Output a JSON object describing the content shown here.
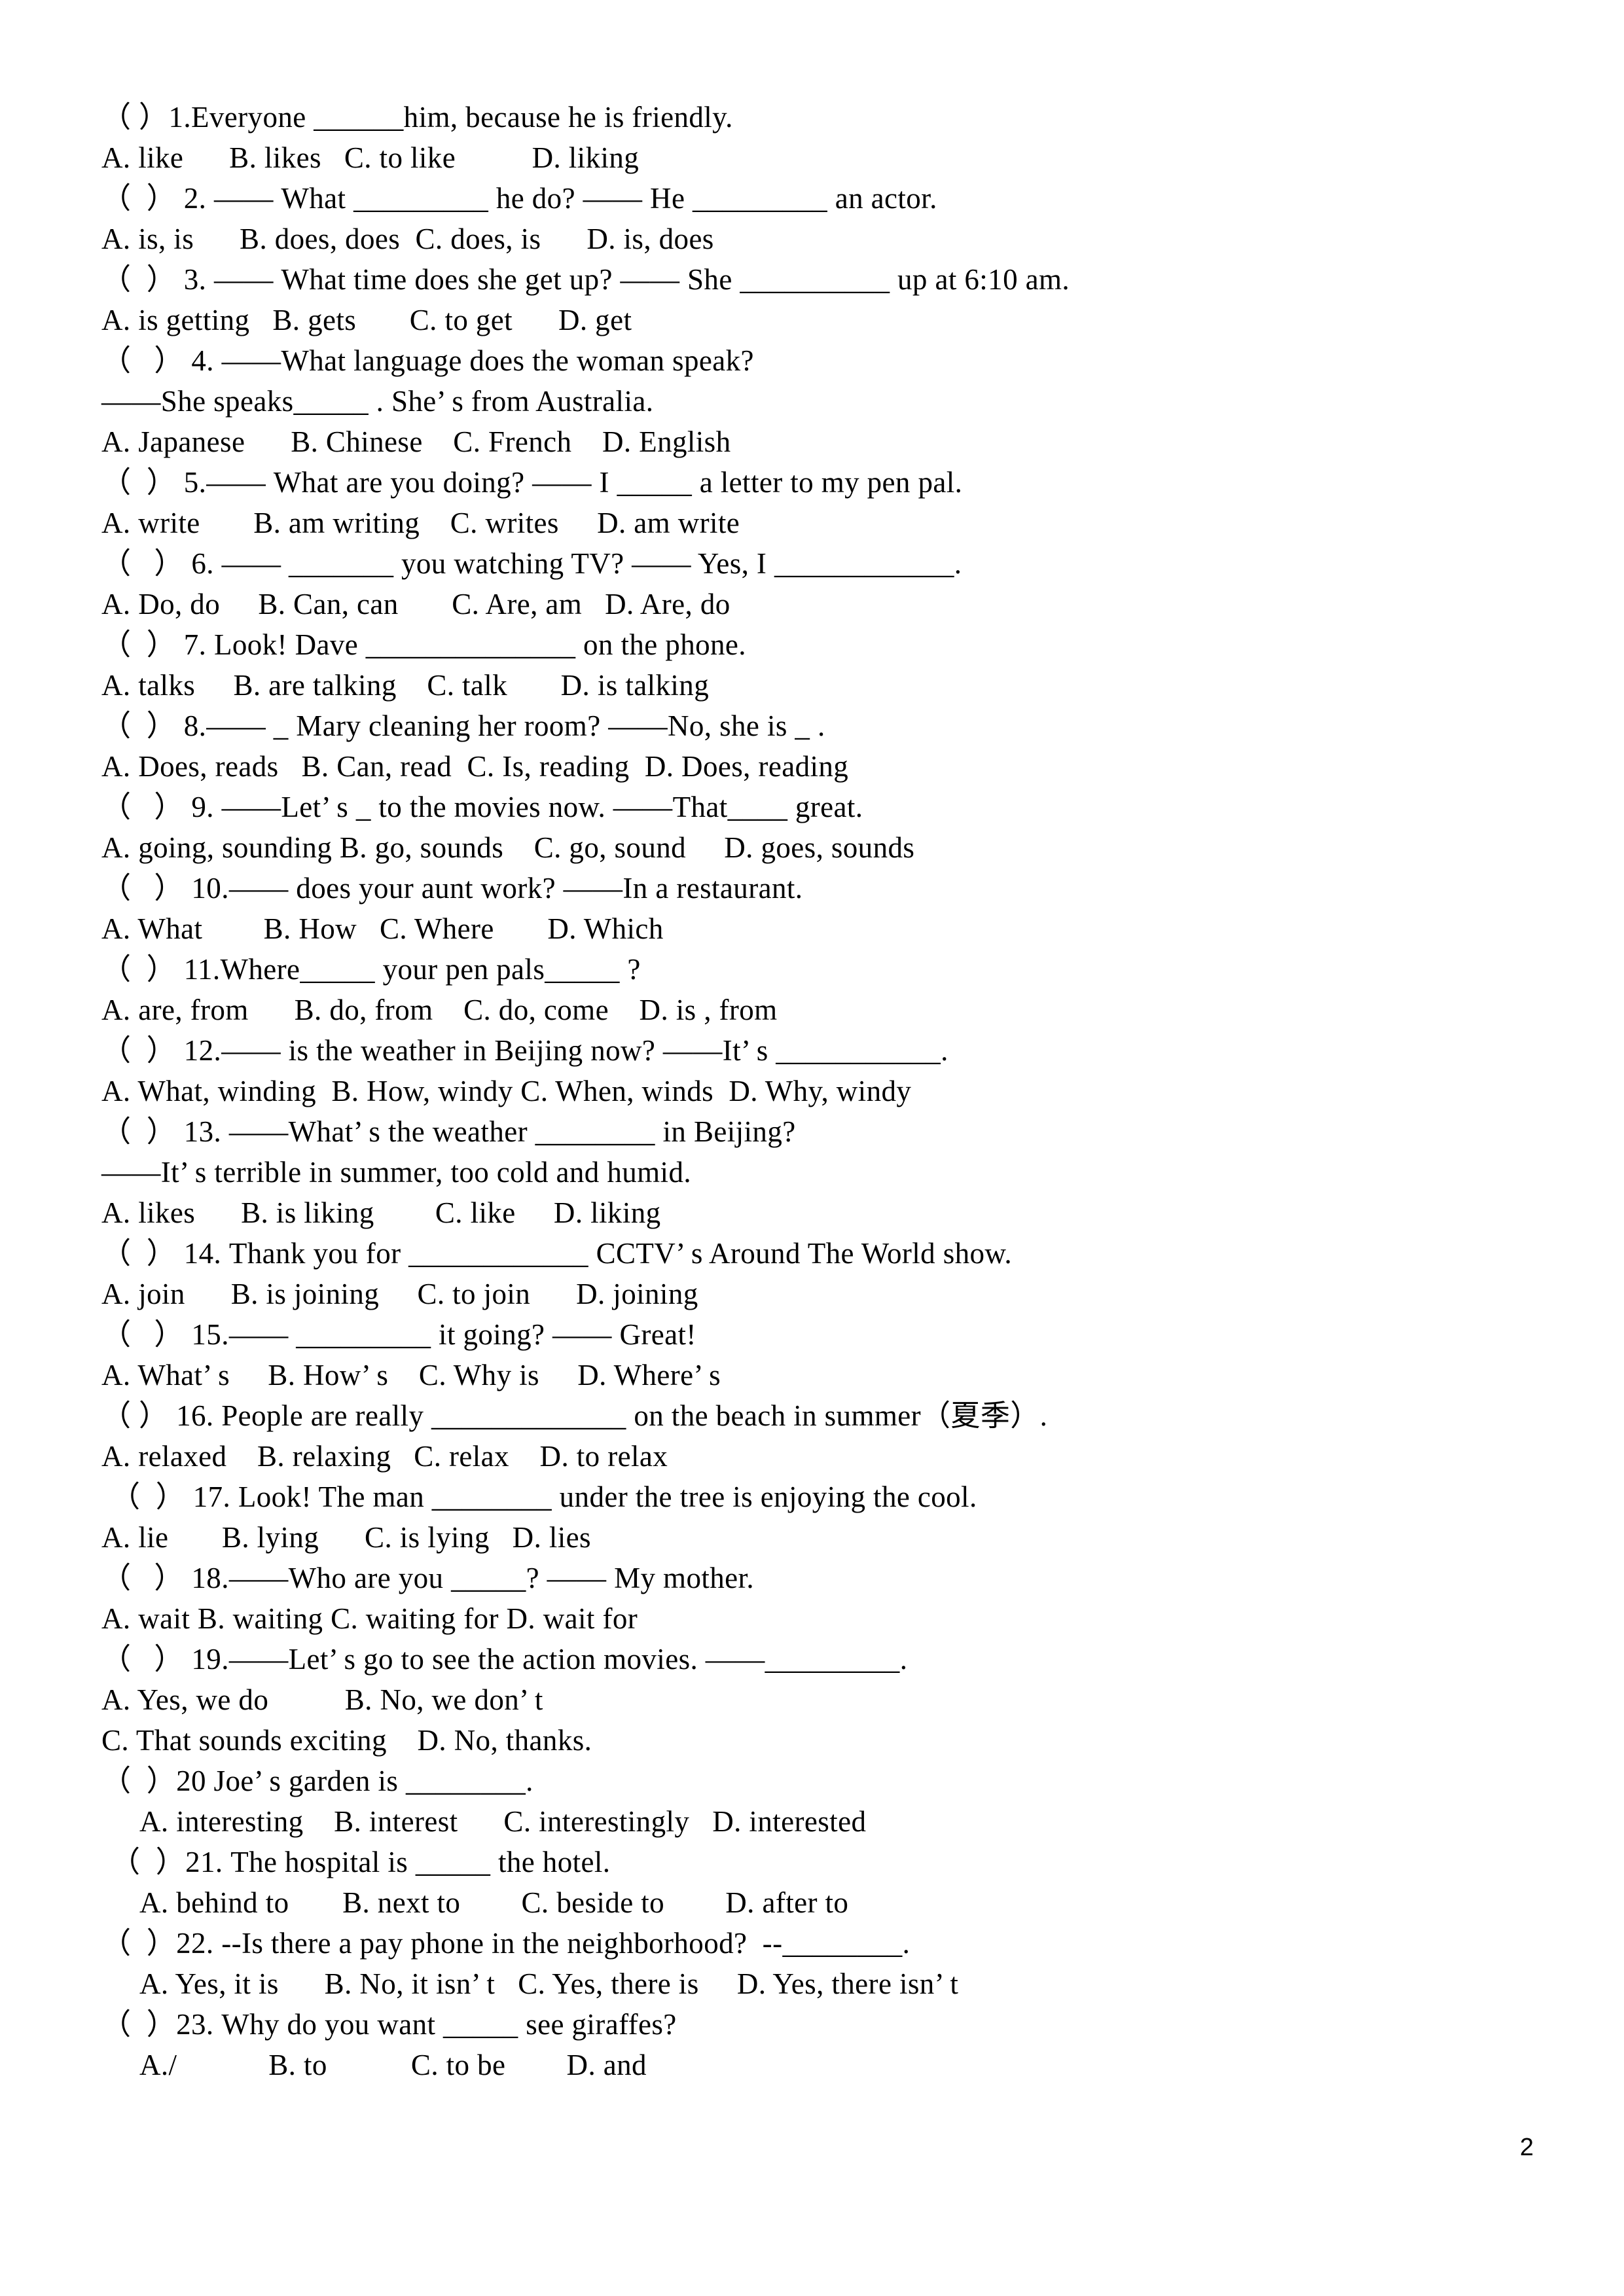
{
  "document": {
    "page_number": "2",
    "type": "multiple-choice-grammar-worksheet"
  },
  "lines": [
    {
      "id": "q1-stem",
      "indent": 0,
      "text": "（ ）1.Everyone ______him, because he is friendly."
    },
    {
      "id": "q1-options",
      "indent": 0,
      "text": "A. like      B. likes   C. to like          D. liking"
    },
    {
      "id": "q2-stem",
      "indent": 0,
      "text": "（  ） 2. —— What _________ he do? —— He _________ an actor."
    },
    {
      "id": "q2-options",
      "indent": 0,
      "text": "A. is, is      B. does, does  C. does, is      D. is, does"
    },
    {
      "id": "q3-stem",
      "indent": 0,
      "text": "（  ） 3. —— What time does she get up? —— She __________ up at 6:10 am."
    },
    {
      "id": "q3-options",
      "indent": 0,
      "text": "A. is getting   B. gets       C. to get      D. get"
    },
    {
      "id": "q4-stem",
      "indent": 0,
      "text": "（   ） 4. ——What language does the woman speak?"
    },
    {
      "id": "q4-stem2",
      "indent": 0,
      "text": "——She speaks_____ . She’ s from Australia."
    },
    {
      "id": "q4-options",
      "indent": 0,
      "text": "A. Japanese      B. Chinese    C. French    D. English"
    },
    {
      "id": "q5-stem",
      "indent": 0,
      "text": "（  ） 5.—— What are you doing? —— I _____ a letter to my pen pal."
    },
    {
      "id": "q5-options",
      "indent": 0,
      "text": "A. write       B. am writing    C. writes     D. am write"
    },
    {
      "id": "q6-stem",
      "indent": 0,
      "text": "（   ） 6. —— _______ you watching TV? —— Yes, I ____________."
    },
    {
      "id": "q6-options",
      "indent": 0,
      "text": "A. Do, do     B. Can, can       C. Are, am   D. Are, do"
    },
    {
      "id": "q7-stem",
      "indent": 0,
      "text": "（  ） 7. Look! Dave ______________ on the phone."
    },
    {
      "id": "q7-options",
      "indent": 0,
      "text": "A. talks     B. are talking    C. talk       D. is talking"
    },
    {
      "id": "q8-stem",
      "indent": 0,
      "text": "（  ） 8.—— _ Mary cleaning her room? ——No, she is _ ."
    },
    {
      "id": "q8-options",
      "indent": 0,
      "text": "A. Does, reads   B. Can, read  C. Is, reading  D. Does, reading"
    },
    {
      "id": "q9-stem",
      "indent": 0,
      "text": "（   ） 9. ——Let’ s _ to the movies now. ——That____ great."
    },
    {
      "id": "q9-options",
      "indent": 0,
      "text": "A. going, sounding B. go, sounds    C. go, sound     D. goes, sounds"
    },
    {
      "id": "q10-stem",
      "indent": 0,
      "text": "（   ） 10.—— does your aunt work? ——In a restaurant."
    },
    {
      "id": "q10-options",
      "indent": 0,
      "text": "A. What        B. How   C. Where       D. Which"
    },
    {
      "id": "q11-stem",
      "indent": 0,
      "text": "（  ） 11.Where_____ your pen pals_____ ?"
    },
    {
      "id": "q11-options",
      "indent": 0,
      "text": "A. are, from      B. do, from    C. do, come    D. is , from"
    },
    {
      "id": "q12-stem",
      "indent": 0,
      "text": "（  ） 12.—— is the weather in Beijing now? ——It’ s ___________."
    },
    {
      "id": "q12-options",
      "indent": 0,
      "text": "A. What, winding  B. How, windy C. When, winds  D. Why, windy"
    },
    {
      "id": "q13-stem",
      "indent": 0,
      "text": "（  ） 13. ——What’ s the weather ________ in Beijing?"
    },
    {
      "id": "q13-stem2",
      "indent": 0,
      "text": "——It’ s terrible in summer, too cold and humid."
    },
    {
      "id": "q13-options",
      "indent": 0,
      "text": "A. likes      B. is liking        C. like     D. liking"
    },
    {
      "id": "q14-stem",
      "indent": 0,
      "text": "（  ） 14. Thank you for ____________ CCTV’ s Around The World show."
    },
    {
      "id": "q14-options",
      "indent": 0,
      "text": "A. join      B. is joining     C. to join      D. joining"
    },
    {
      "id": "q15-stem",
      "indent": 0,
      "text": "（   ） 15.—— _________ it going? —— Great!"
    },
    {
      "id": "q15-options",
      "indent": 0,
      "text": "A. What’ s     B. How’ s    C. Why is     D. Where’ s"
    },
    {
      "id": "q16-stem",
      "indent": 0,
      "text": "（ ） 16. People are really _____________ on the beach in summer（夏季）."
    },
    {
      "id": "q16-options",
      "indent": 0,
      "text": "A. relaxed    B. relaxing   C. relax    D. to relax"
    },
    {
      "id": "q17-stem",
      "indent": 1,
      "text": "（  ） 17. Look! The man ________ under the tree is enjoying the cool."
    },
    {
      "id": "q17-options",
      "indent": 0,
      "text": "A. lie       B. lying      C. is lying   D. lies"
    },
    {
      "id": "q18-stem",
      "indent": 0,
      "text": "（   ） 18.——Who are you _____? —— My mother."
    },
    {
      "id": "q18-options",
      "indent": 0,
      "text": "A. wait B. waiting C. waiting for D. wait for"
    },
    {
      "id": "q19-stem",
      "indent": 0,
      "text": "（   ） 19.——Let’ s go to see the action movies. ——_________."
    },
    {
      "id": "q19-optionsA",
      "indent": 0,
      "text": "A. Yes, we do          B. No, we don’ t"
    },
    {
      "id": "q19-optionsC",
      "indent": 0,
      "text": "C. That sounds exciting    D. No, thanks."
    },
    {
      "id": "q20-stem",
      "indent": 0,
      "text": "（  ）20 Joe’ s garden is ________."
    },
    {
      "id": "q20-options",
      "indent": 3,
      "text": "A. interesting    B. interest      C. interestingly   D. interested"
    },
    {
      "id": "q21-stem",
      "indent": 1,
      "text": "（  ）21. The hospital is _____ the hotel."
    },
    {
      "id": "q21-options",
      "indent": 3,
      "text": "A. behind to       B. next to        C. beside to        D. after to"
    },
    {
      "id": "q22-stem",
      "indent": 0,
      "text": "（  ）22. --Is there a pay phone in the neighborhood?  --________."
    },
    {
      "id": "q22-options",
      "indent": 3,
      "text": "A. Yes, it is      B. No, it isn’ t   C. Yes, there is     D. Yes, there isn’ t"
    },
    {
      "id": "q23-stem",
      "indent": 0,
      "text": "（  ）23. Why do you want _____ see giraffes?"
    },
    {
      "id": "q23-options",
      "indent": 3,
      "text": "A./            B. to           C. to be        D. and"
    }
  ]
}
